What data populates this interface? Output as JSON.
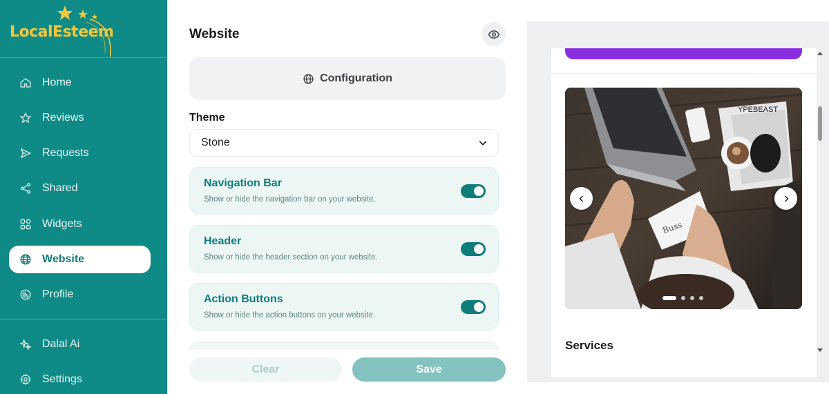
{
  "brand": {
    "logo_text": "LocalEsteem",
    "logo_color": "#f3c73a",
    "sidebar_color": "#0f8a86"
  },
  "sidebar": {
    "items": [
      {
        "label": "Home",
        "icon": "home-icon",
        "active": false
      },
      {
        "label": "Reviews",
        "icon": "star-icon",
        "active": false
      },
      {
        "label": "Requests",
        "icon": "send-icon",
        "active": false
      },
      {
        "label": "Shared",
        "icon": "share-icon",
        "active": false
      },
      {
        "label": "Widgets",
        "icon": "widgets-icon",
        "active": false
      },
      {
        "label": "Website",
        "icon": "globe-icon",
        "active": true
      },
      {
        "label": "Profile",
        "icon": "target-icon",
        "active": false
      }
    ],
    "bottom_items": [
      {
        "label": "Dalal Ai",
        "icon": "sparkle-icon"
      },
      {
        "label": "Settings",
        "icon": "gear-icon"
      }
    ]
  },
  "panel": {
    "title": "Website",
    "config_label": "Configuration",
    "theme_label": "Theme",
    "theme_value": "Stone",
    "options": [
      {
        "title": "Navigation Bar",
        "desc": "Show or hide the navigation bar on your website.",
        "enabled": true
      },
      {
        "title": "Header",
        "desc": "Show or hide the header section on your website.",
        "enabled": true
      },
      {
        "title": "Action Buttons",
        "desc": "Show or hide the action buttons on your website.",
        "enabled": true
      }
    ],
    "clear_label": "Clear",
    "save_label": "Save",
    "accent": "#0f7d79"
  },
  "preview": {
    "accent_bar_color": "#8a2fe0",
    "carousel": {
      "slides": 4,
      "active_slide": 1,
      "image": "desk-with-laptop-photo"
    },
    "section_title": "Services"
  }
}
